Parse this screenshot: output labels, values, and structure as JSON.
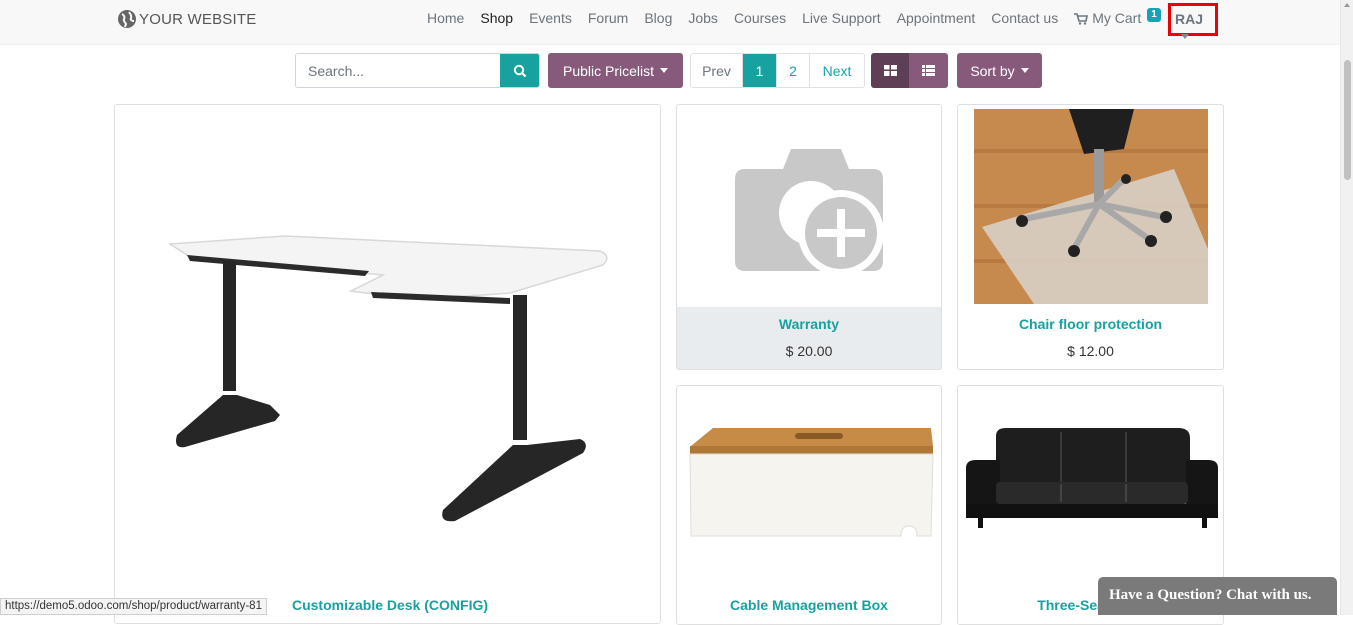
{
  "header": {
    "logo_text": "YOUR WEBSITE",
    "nav": [
      "Home",
      "Shop",
      "Events",
      "Forum",
      "Blog",
      "Jobs",
      "Courses",
      "Live Support",
      "Appointment",
      "Contact us"
    ],
    "active_nav": "Shop",
    "cart_label": "My Cart",
    "cart_count": "1",
    "user_label": "RAJ"
  },
  "toolbar": {
    "search_placeholder": "Search...",
    "pricelist_label": "Public Pricelist",
    "pager": {
      "prev": "Prev",
      "pages": [
        "1",
        "2"
      ],
      "current": "1",
      "next": "Next"
    },
    "sort_label": "Sort by"
  },
  "products": [
    {
      "name": "Customizable Desk (CONFIG)",
      "price": ""
    },
    {
      "name": "Warranty",
      "price": "$ 20.00"
    },
    {
      "name": "Chair floor protection",
      "price": "$ 12.00"
    },
    {
      "name": "Cable Management Box",
      "price": ""
    },
    {
      "name": "Three-Seat Sofa",
      "price": ""
    }
  ],
  "status_url": "https://demo5.odoo.com/shop/product/warranty-81",
  "chat_label": "Have a Question? Chat with us.",
  "colors": {
    "accent": "#17a2a0",
    "brand": "#875a7b",
    "highlight": "#e00000"
  }
}
